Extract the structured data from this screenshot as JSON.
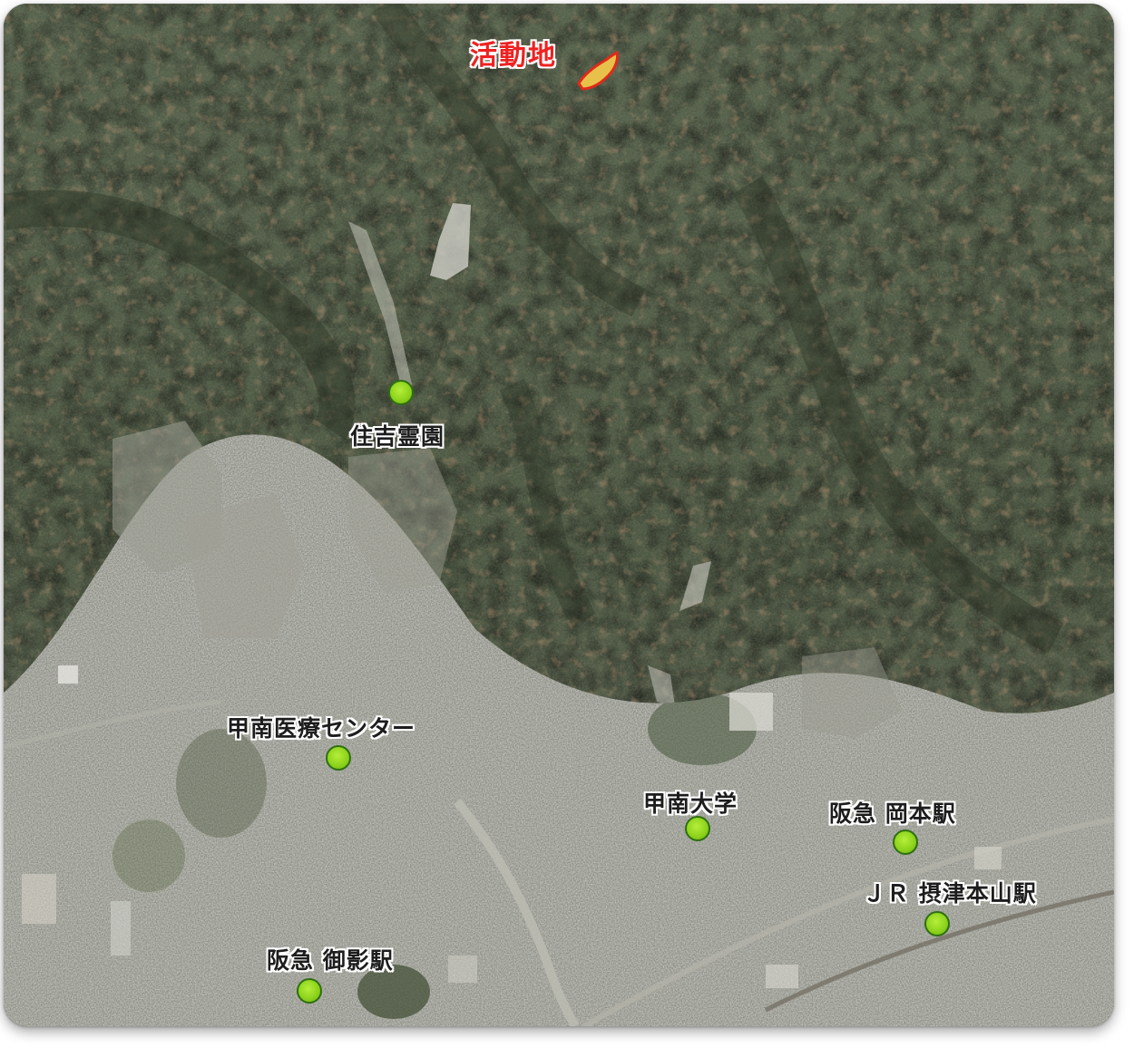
{
  "map": {
    "activity_site": {
      "label": "活動地",
      "label_color": "#ee2222",
      "area_fill": "#e8c14a",
      "area_outline": "#e02a1a"
    },
    "marker_color": "#8fd41c",
    "places": [
      {
        "id": "sumiyoshi-cemetery",
        "label": "住吉霊園"
      },
      {
        "id": "konan-medical-center",
        "label": "甲南医療センター"
      },
      {
        "id": "konan-university",
        "label": "甲南大学"
      },
      {
        "id": "hankyu-okamoto-station",
        "label": "阪急  岡本駅"
      },
      {
        "id": "jr-settsu-motoyama-station",
        "label": "ＪＲ  摂津本山駅"
      },
      {
        "id": "hankyu-mikage-station",
        "label": "阪急  御影駅"
      }
    ]
  }
}
